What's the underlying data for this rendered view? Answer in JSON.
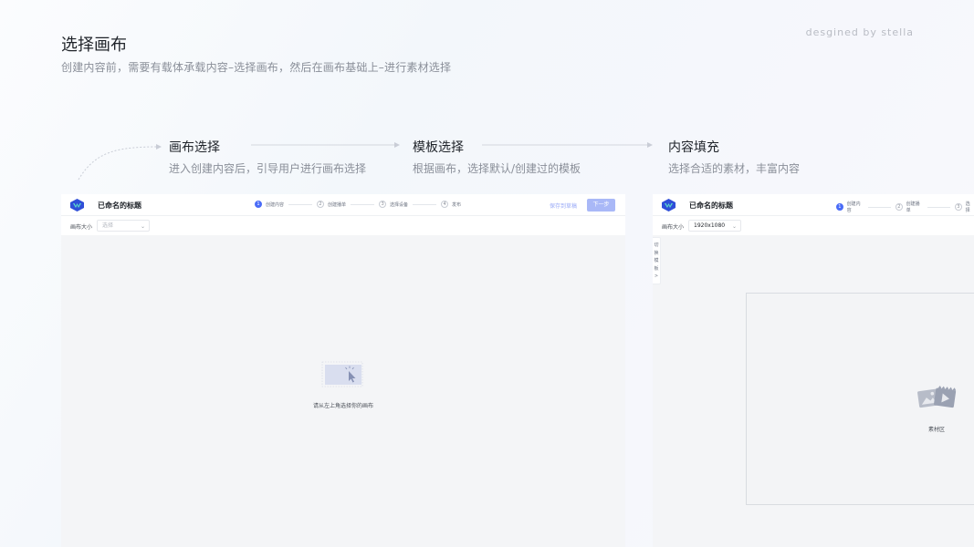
{
  "slide": {
    "title": "选择画布",
    "subtitle": "创建内容前，需要有载体承载内容–选择画布，然后在画布基础上–进行素材选择",
    "credit": "desgined by stella"
  },
  "steps": [
    {
      "title": "画布选择",
      "desc": "进入创建内容后，引导用户进行画布选择"
    },
    {
      "title": "模板选择",
      "desc": "根据画布，选择默认/创建过的模板"
    },
    {
      "title": "内容填充",
      "desc": "选择合适的素材，丰富内容"
    }
  ],
  "mock_left": {
    "name": "已命名的标题",
    "steps": [
      {
        "num": "1",
        "label": "创建内容"
      },
      {
        "num": "2",
        "label": "创建播单"
      },
      {
        "num": "3",
        "label": "选择设备"
      },
      {
        "num": "4",
        "label": "发布"
      }
    ],
    "save_draft": "保存到草稿",
    "next": "下一步",
    "size_label": "画布大小",
    "size_placeholder": "选择",
    "empty_text": "请从左上角选择你的画布"
  },
  "mock_right": {
    "name": "已命名的标题",
    "steps": [
      {
        "num": "1",
        "label": "创建内容"
      },
      {
        "num": "2",
        "label": "创建播单"
      },
      {
        "num": "3",
        "label": "选择"
      }
    ],
    "size_label": "画布大小",
    "size_value": "1920x1080",
    "side_tab": "切换模板",
    "side_tab_arrow": ">",
    "material_text": "素材区"
  },
  "colors": {
    "accent": "#4a6cf7",
    "accent_light": "#a9b8f7",
    "text_primary": "#1f2329",
    "text_secondary": "#8a8f99"
  }
}
